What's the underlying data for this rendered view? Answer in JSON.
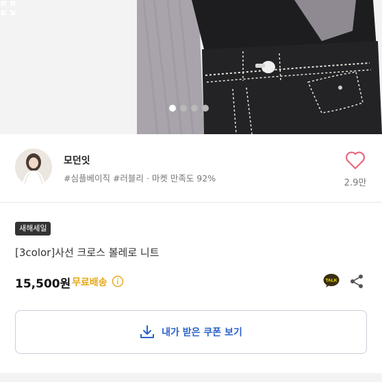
{
  "gallery": {
    "page_count": 4,
    "active_index": 0,
    "expand_icon": "expand-icon"
  },
  "shop": {
    "name": "모던잇",
    "meta": "#심플베이직 #러블리 · 마켓 만족도 92%",
    "like_count": "2.9만",
    "like_icon": "heart-outline-icon",
    "accent_color": "#e8667b"
  },
  "product": {
    "badge": "새해세일",
    "title": "[3color]사선 크로스 볼레로 니트",
    "price": "15,500원",
    "shipping": "무료배송",
    "shipping_color": "#e6a817"
  },
  "actions": {
    "talk_label": "TALK",
    "coupon_label": "내가 받은 쿠폰 보기",
    "coupon_color": "#2c62c9"
  }
}
